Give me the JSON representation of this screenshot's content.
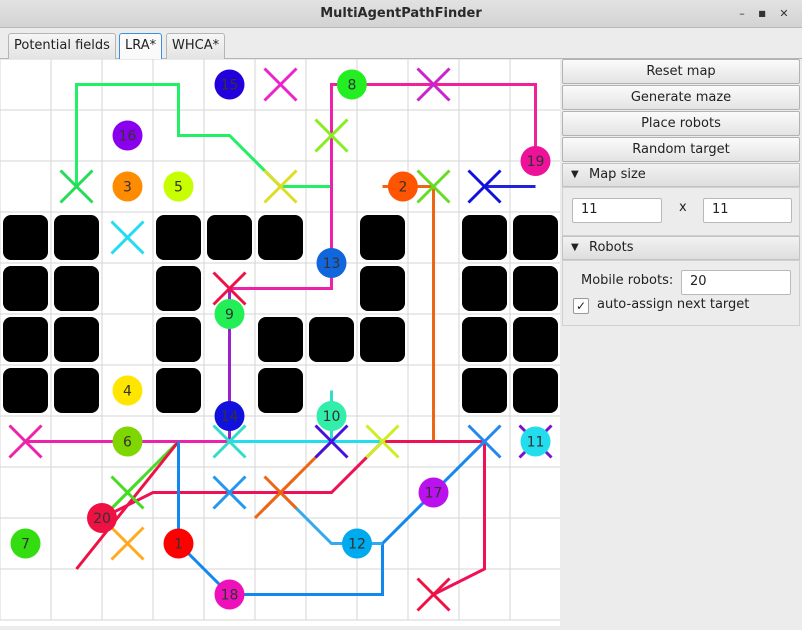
{
  "window": {
    "title": "MultiAgentPathFinder",
    "min_label": "–",
    "max_label": "■",
    "close_label": "✕"
  },
  "tabs": [
    {
      "label": "Potential fields",
      "active": false
    },
    {
      "label": "LRA*",
      "active": true
    },
    {
      "label": "WHCA*",
      "active": false
    }
  ],
  "side": {
    "reset_label": "Reset map",
    "generate_label": "Generate maze",
    "place_label": "Place robots",
    "random_label": "Random target",
    "map_size": {
      "title": "Map size",
      "width": "11",
      "separator": "x",
      "height": "11"
    },
    "robots": {
      "title": "Robots",
      "mobile_label": "Mobile robots:",
      "mobile_value": "20",
      "auto_assign_label": "auto-assign next target",
      "auto_assign_checked": true
    }
  },
  "grid": {
    "cols": 11,
    "rows": 11,
    "walls": [
      [
        0,
        3
      ],
      [
        1,
        3
      ],
      [
        3,
        3
      ],
      [
        4,
        3
      ],
      [
        5,
        3
      ],
      [
        7,
        3
      ],
      [
        9,
        3
      ],
      [
        10,
        3
      ],
      [
        0,
        4
      ],
      [
        1,
        4
      ],
      [
        3,
        4
      ],
      [
        7,
        4
      ],
      [
        9,
        4
      ],
      [
        10,
        4
      ],
      [
        0,
        5
      ],
      [
        1,
        5
      ],
      [
        3,
        5
      ],
      [
        5,
        5
      ],
      [
        6,
        5
      ],
      [
        7,
        5
      ],
      [
        9,
        5
      ],
      [
        10,
        5
      ],
      [
        0,
        6
      ],
      [
        1,
        6
      ],
      [
        3,
        6
      ],
      [
        5,
        6
      ],
      [
        9,
        6
      ],
      [
        10,
        6
      ]
    ],
    "robots": [
      {
        "id": "2",
        "color": "#ff5500",
        "col": 7.9,
        "row": 2.5
      },
      {
        "id": "3",
        "color": "#ff8c00",
        "col": 2.5,
        "row": 2.5
      },
      {
        "id": "4",
        "color": "#ffe600",
        "col": 2.5,
        "row": 6.5
      },
      {
        "id": "5",
        "color": "#c8ff00",
        "col": 3.5,
        "row": 2.5
      },
      {
        "id": "6",
        "color": "#7fd600",
        "col": 2.5,
        "row": 7.5
      },
      {
        "id": "7",
        "color": "#33dd11",
        "col": 0.5,
        "row": 9.5
      },
      {
        "id": "8",
        "color": "#22ee22",
        "col": 6.9,
        "row": 0.5
      },
      {
        "id": "9",
        "color": "#22ee55",
        "col": 4.5,
        "row": 5
      },
      {
        "id": "10",
        "color": "#33eeaa",
        "col": 6.5,
        "row": 7
      },
      {
        "id": "11",
        "color": "#22ddee",
        "col": 10.5,
        "row": 7.5
      },
      {
        "id": "12",
        "color": "#00aaee",
        "col": 7,
        "row": 9.5
      },
      {
        "id": "13",
        "color": "#1166dd",
        "col": 6.5,
        "row": 4
      },
      {
        "id": "14",
        "color": "#1111dd",
        "col": 4.5,
        "row": 7
      },
      {
        "id": "15",
        "color": "#2200dd",
        "col": 4.5,
        "row": 0.5
      },
      {
        "id": "16",
        "color": "#8a00ee",
        "col": 2.5,
        "row": 1.5
      },
      {
        "id": "17",
        "color": "#bb11ee",
        "col": 8.5,
        "row": 8.5
      },
      {
        "id": "18",
        "color": "#ee11bb",
        "col": 4.5,
        "row": 10.5
      },
      {
        "id": "19",
        "color": "#ee1199",
        "col": 10.5,
        "row": 2
      },
      {
        "id": "20",
        "color": "#ee1144",
        "col": 2,
        "row": 9
      },
      {
        "id": "1",
        "color": "#ff0000",
        "col": 3.5,
        "row": 9.5
      }
    ],
    "targets": [
      {
        "color": "#ee22cc",
        "col": 5.5,
        "row": 0.5
      },
      {
        "color": "#cc22cc",
        "col": 8.5,
        "row": 0.5
      },
      {
        "color": "#88ee22",
        "col": 6.5,
        "row": 1.5
      },
      {
        "color": "#22dd55",
        "col": 1.5,
        "row": 2.5
      },
      {
        "color": "#dddd22",
        "col": 5.5,
        "row": 2.5
      },
      {
        "color": "#66dd22",
        "col": 8.5,
        "row": 2.5
      },
      {
        "color": "#1111dd",
        "col": 9.5,
        "row": 2.5
      },
      {
        "color": "#22ddee",
        "col": 2.5,
        "row": 3.5
      },
      {
        "color": "#ee1144",
        "col": 4.5,
        "row": 4.5
      },
      {
        "color": "#ee22aa",
        "col": 0.5,
        "row": 7.5
      },
      {
        "color": "#33ddcc",
        "col": 4.5,
        "row": 7.5
      },
      {
        "color": "#4411dd",
        "col": 6.5,
        "row": 7.5
      },
      {
        "color": "#ccee22",
        "col": 7.5,
        "row": 7.5
      },
      {
        "color": "#2288ee",
        "col": 9.5,
        "row": 7.5
      },
      {
        "color": "#7711cc",
        "col": 10.5,
        "row": 7.5
      },
      {
        "color": "#44dd22",
        "col": 2.5,
        "row": 8.5
      },
      {
        "color": "#2299ee",
        "col": 4.5,
        "row": 8.5
      },
      {
        "color": "#ee6611",
        "col": 5.5,
        "row": 8.5
      },
      {
        "color": "#ffaa22",
        "col": 2.5,
        "row": 9.5
      },
      {
        "color": "#ee1144",
        "col": 8.5,
        "row": 10.5
      }
    ],
    "paths": [
      {
        "color": "#22ee66",
        "points": [
          [
            1.5,
            2.5
          ],
          [
            1.5,
            0.5
          ],
          [
            3.5,
            0.5
          ],
          [
            3.5,
            1.5
          ],
          [
            4.5,
            1.5
          ],
          [
            5.5,
            2.5
          ],
          [
            6.5,
            2.5
          ]
        ]
      },
      {
        "color": "#ee2299",
        "points": [
          [
            6.5,
            2.5
          ],
          [
            6.5,
            0.5
          ],
          [
            10.5,
            0.5
          ],
          [
            10.5,
            2
          ]
        ]
      },
      {
        "color": "#ee22aa",
        "points": [
          [
            0.5,
            7.5
          ],
          [
            4.5,
            7.5
          ],
          [
            4.5,
            4.5
          ],
          [
            6.5,
            4.5
          ],
          [
            6.5,
            0.5
          ]
        ]
      },
      {
        "color": "#9922cc",
        "points": [
          [
            4.5,
            4.5
          ],
          [
            4.5,
            7.5
          ]
        ]
      },
      {
        "color": "#2222dd",
        "points": [
          [
            10.5,
            2.5
          ],
          [
            9.5,
            2.5
          ]
        ]
      },
      {
        "color": "#ee6611",
        "points": [
          [
            7.5,
            2.5
          ],
          [
            8.5,
            2.5
          ],
          [
            8.5,
            7.5
          ],
          [
            6.5,
            7.5
          ],
          [
            5.5,
            8.5
          ],
          [
            5,
            9
          ]
        ]
      },
      {
        "color": "#33ddcc",
        "points": [
          [
            4.5,
            7.5
          ],
          [
            6.5,
            7.5
          ],
          [
            6.5,
            6.5
          ]
        ]
      },
      {
        "color": "#44dd22",
        "points": [
          [
            3.5,
            7.5
          ],
          [
            2.5,
            8.5
          ],
          [
            2,
            9
          ]
        ]
      },
      {
        "color": "#ee1144",
        "points": [
          [
            1.5,
            10
          ],
          [
            3.5,
            7.5
          ]
        ]
      },
      {
        "color": "#ee1155",
        "points": [
          [
            2,
            9
          ],
          [
            3,
            8.5
          ],
          [
            6.5,
            8.5
          ],
          [
            7.5,
            7.5
          ],
          [
            9.5,
            7.5
          ],
          [
            9.5,
            10
          ],
          [
            8.5,
            10.5
          ]
        ]
      },
      {
        "color": "#1188ee",
        "points": [
          [
            3.5,
            7.5
          ],
          [
            3.5,
            9.5
          ],
          [
            4.5,
            10.5
          ],
          [
            7.5,
            10.5
          ],
          [
            7.5,
            9.5
          ],
          [
            9.5,
            7.5
          ]
        ]
      },
      {
        "color": "#33aaee",
        "points": [
          [
            5.5,
            8.5
          ],
          [
            6.5,
            9.5
          ],
          [
            7.5,
            9.5
          ]
        ]
      },
      {
        "color": "#22ddee",
        "points": [
          [
            4.5,
            7.5
          ],
          [
            7.5,
            7.5
          ]
        ]
      }
    ]
  }
}
